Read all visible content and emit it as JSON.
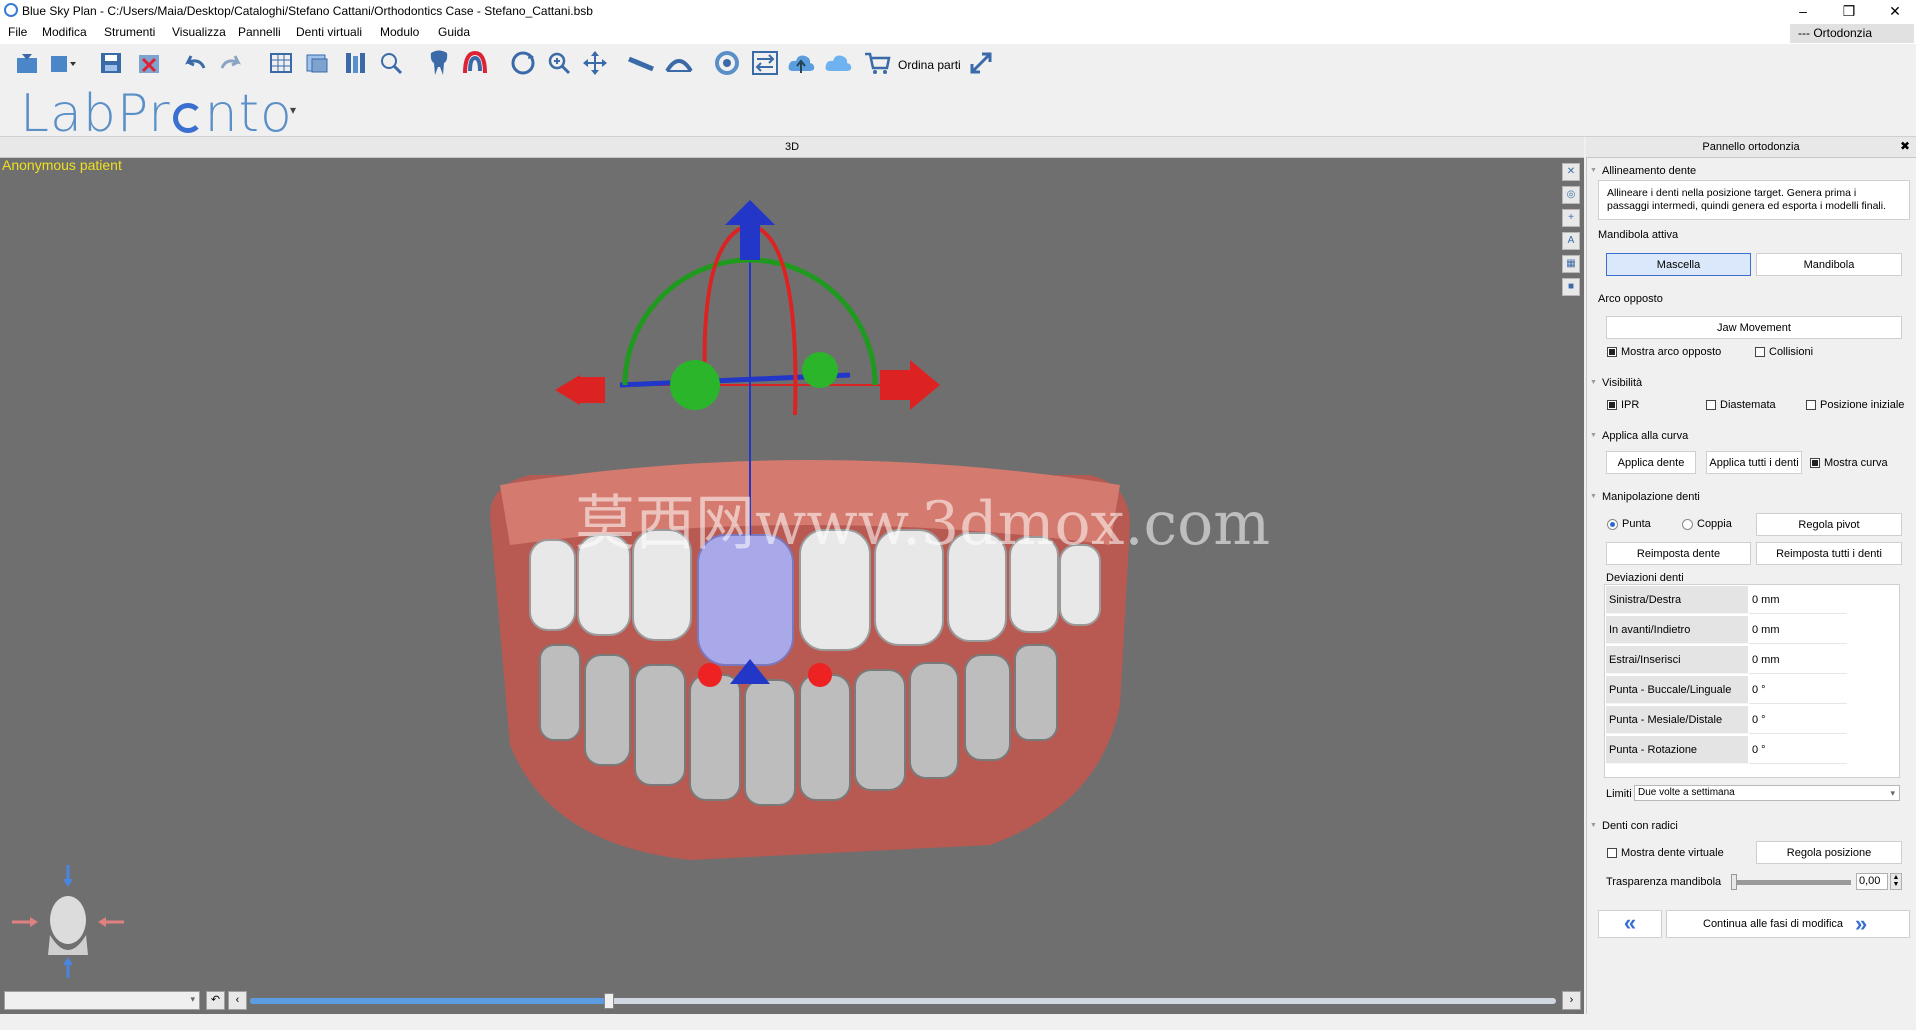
{
  "window": {
    "title": "Blue Sky Plan - C:/Users/Maia/Desktop/Cataloghi/Stefano Cattani/Orthodontics Case - Stefano_Cattani.bsb",
    "minimize": "–",
    "restore": "❒",
    "close": "✕"
  },
  "menu": [
    "File",
    "Modifica",
    "Strumenti",
    "Visualizza",
    "Pannelli",
    "Denti virtuali",
    "Modulo",
    "Guida"
  ],
  "mode_tab": "--- Ortodonzia",
  "toolbar": {
    "order_label": "Ordina parti"
  },
  "logo": {
    "text_a": "LabPr",
    "text_b": "nto",
    "caret": "▾"
  },
  "viewport": {
    "header": "3D",
    "patient": "Anonymous patient",
    "watermark": "莫西网www.3dmox.com"
  },
  "panel": {
    "header": "Pannello ortodonzia",
    "close": "✖",
    "alignment": {
      "title": "Allineamento dente",
      "description": "Allineare i denti nella posizione target. Genera prima i passaggi intermedi, quindi genera ed esporta i modelli finali."
    },
    "active_jaw": {
      "title": "Mandibola attiva",
      "maxilla": "Mascella",
      "mandible": "Mandibola"
    },
    "opposite_arch": {
      "title": "Arco opposto",
      "jaw_movement": "Jaw Movement",
      "show_opposite": "Mostra arco opposto",
      "collisions": "Collisioni"
    },
    "visibility": {
      "title": "Visibilità",
      "ipr": "IPR",
      "diastema": "Diastemata",
      "initial_position": "Posizione iniziale"
    },
    "apply_curve": {
      "title": "Applica alla curva",
      "apply_tooth": "Applica dente",
      "apply_all": "Applica tutti i denti",
      "show_curve": "Mostra curva"
    },
    "manipulation": {
      "title": "Manipolazione denti",
      "tip": "Punta",
      "torque": "Coppia",
      "adjust_pivot": "Regola pivot",
      "reset_tooth": "Reimposta dente",
      "reset_all": "Reimposta tutti i denti",
      "deviations_title": "Deviazioni denti",
      "deviations": [
        {
          "label": "Sinistra/Destra",
          "value": "0 mm"
        },
        {
          "label": "In avanti/Indietro",
          "value": "0 mm"
        },
        {
          "label": "Estrai/Inserisci",
          "value": "0 mm"
        },
        {
          "label": "Punta - Buccale/Linguale",
          "value": "0 °"
        },
        {
          "label": "Punta - Mesiale/Distale",
          "value": "0 °"
        },
        {
          "label": "Punta - Rotazione",
          "value": "0 °"
        }
      ],
      "limits_label": "Limiti",
      "limits_value": "Due volte a settimana"
    },
    "roots": {
      "title": "Denti con radici",
      "show_virtual": "Mostra dente virtuale",
      "adjust_position": "Regola posizione",
      "transparency_label": "Trasparenza mandibola",
      "transparency_value": "0,00"
    },
    "nav": {
      "back": "«",
      "continue": "Continua alle fasi di modifica",
      "forward": "»"
    }
  },
  "colors": {
    "viewport_bg": "#6f6f6f",
    "accent": "#3a6fd0",
    "gum": "#c9655b",
    "patient_label": "#f0e020"
  }
}
